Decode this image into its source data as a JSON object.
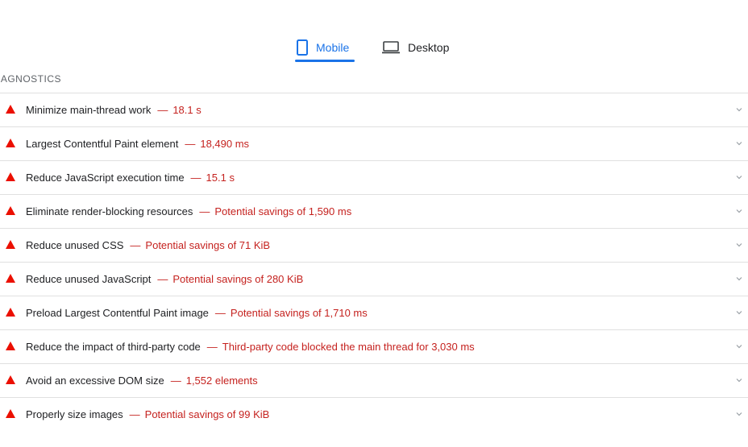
{
  "tabs": {
    "mobile_label": "Mobile",
    "desktop_label": "Desktop",
    "active": "Mobile"
  },
  "section": {
    "title": "IAGNOSTICS"
  },
  "colors": {
    "accent": "#1a73e8",
    "fail": "#eb0f00",
    "fail_text": "#c5221f"
  },
  "audits": [
    {
      "title": "Minimize main-thread work",
      "value": "18.1 s"
    },
    {
      "title": "Largest Contentful Paint element",
      "value": "18,490 ms"
    },
    {
      "title": "Reduce JavaScript execution time",
      "value": "15.1 s"
    },
    {
      "title": "Eliminate render-blocking resources",
      "value": "Potential savings of 1,590 ms"
    },
    {
      "title": "Reduce unused CSS",
      "value": "Potential savings of 71 KiB"
    },
    {
      "title": "Reduce unused JavaScript",
      "value": "Potential savings of 280 KiB"
    },
    {
      "title": "Preload Largest Contentful Paint image",
      "value": "Potential savings of 1,710 ms"
    },
    {
      "title": "Reduce the impact of third-party code",
      "value": "Third-party code blocked the main thread for 3,030 ms"
    },
    {
      "title": "Avoid an excessive DOM size",
      "value": "1,552 elements"
    },
    {
      "title": "Properly size images",
      "value": "Potential savings of 99 KiB"
    }
  ],
  "separator": "—"
}
